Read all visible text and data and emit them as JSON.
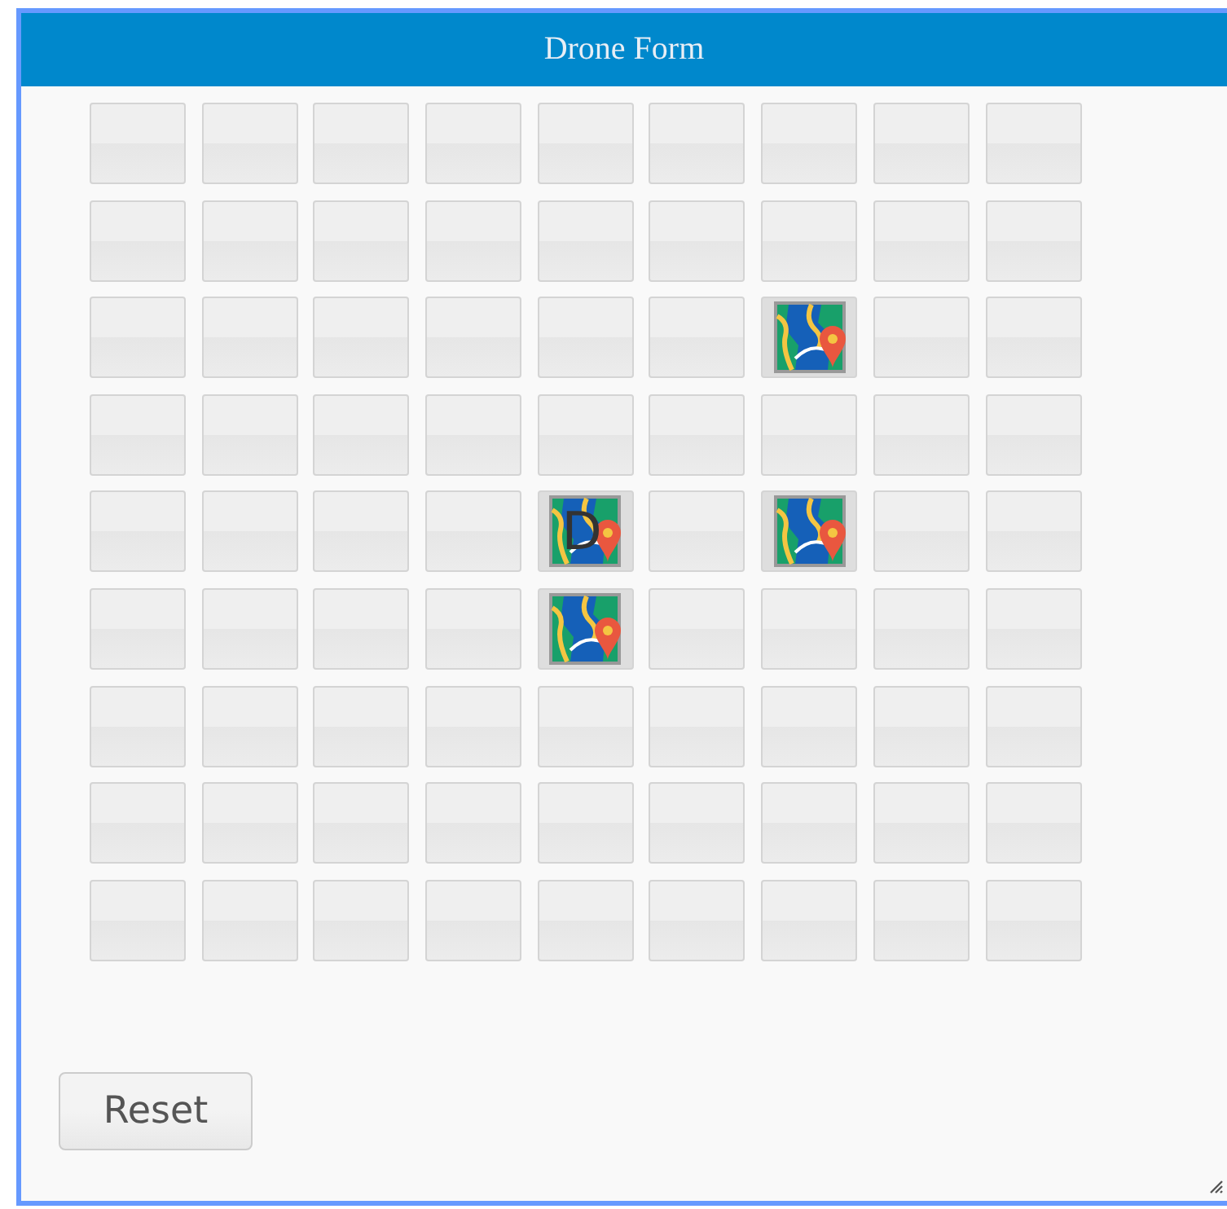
{
  "window": {
    "title": "Drone Form"
  },
  "grid": [
    [
      {
        "kind": "empty"
      },
      {
        "kind": "empty"
      },
      {
        "kind": "empty"
      },
      {
        "kind": "empty"
      },
      {
        "kind": "empty"
      },
      {
        "kind": "empty"
      },
      {
        "kind": "empty"
      },
      {
        "kind": "empty"
      },
      {
        "kind": "empty"
      }
    ],
    [
      {
        "kind": "empty"
      },
      {
        "kind": "empty"
      },
      {
        "kind": "empty"
      },
      {
        "kind": "empty"
      },
      {
        "kind": "empty"
      },
      {
        "kind": "empty"
      },
      {
        "kind": "empty"
      },
      {
        "kind": "empty"
      },
      {
        "kind": "empty"
      }
    ],
    [
      {
        "kind": "empty"
      },
      {
        "kind": "empty"
      },
      {
        "kind": "empty"
      },
      {
        "kind": "empty"
      },
      {
        "kind": "empty"
      },
      {
        "kind": "empty"
      },
      {
        "kind": "map"
      },
      {
        "kind": "empty"
      },
      {
        "kind": "empty"
      }
    ],
    [
      {
        "kind": "empty"
      },
      {
        "kind": "empty"
      },
      {
        "kind": "empty"
      },
      {
        "kind": "empty"
      },
      {
        "kind": "empty"
      },
      {
        "kind": "empty"
      },
      {
        "kind": "empty"
      },
      {
        "kind": "empty"
      },
      {
        "kind": "empty"
      }
    ],
    [
      {
        "kind": "empty"
      },
      {
        "kind": "empty"
      },
      {
        "kind": "empty"
      },
      {
        "kind": "empty"
      },
      {
        "kind": "map",
        "label": "D"
      },
      {
        "kind": "empty"
      },
      {
        "kind": "map"
      },
      {
        "kind": "empty"
      },
      {
        "kind": "empty"
      }
    ],
    [
      {
        "kind": "empty"
      },
      {
        "kind": "empty"
      },
      {
        "kind": "empty"
      },
      {
        "kind": "empty"
      },
      {
        "kind": "map"
      },
      {
        "kind": "empty"
      },
      {
        "kind": "empty"
      },
      {
        "kind": "empty"
      },
      {
        "kind": "empty"
      }
    ],
    [
      {
        "kind": "empty"
      },
      {
        "kind": "empty"
      },
      {
        "kind": "empty"
      },
      {
        "kind": "empty"
      },
      {
        "kind": "empty"
      },
      {
        "kind": "empty"
      },
      {
        "kind": "empty"
      },
      {
        "kind": "empty"
      },
      {
        "kind": "empty"
      }
    ],
    [
      {
        "kind": "empty"
      },
      {
        "kind": "empty"
      },
      {
        "kind": "empty"
      },
      {
        "kind": "empty"
      },
      {
        "kind": "empty"
      },
      {
        "kind": "empty"
      },
      {
        "kind": "empty"
      },
      {
        "kind": "empty"
      },
      {
        "kind": "empty"
      }
    ],
    [
      {
        "kind": "empty"
      },
      {
        "kind": "empty"
      },
      {
        "kind": "empty"
      },
      {
        "kind": "empty"
      },
      {
        "kind": "empty"
      },
      {
        "kind": "empty"
      },
      {
        "kind": "empty"
      },
      {
        "kind": "empty"
      },
      {
        "kind": "empty"
      }
    ]
  ],
  "reset_button": "Reset"
}
